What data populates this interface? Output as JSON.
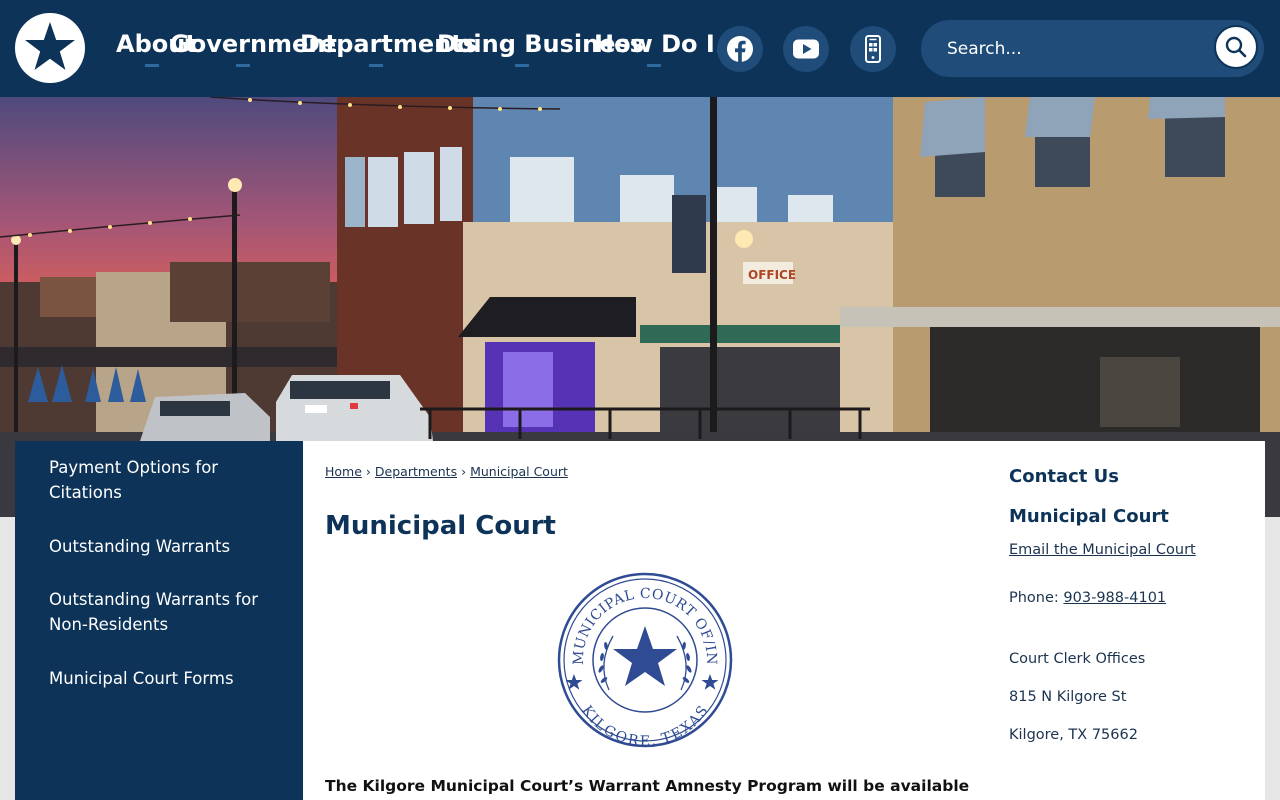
{
  "header": {
    "nav": [
      {
        "label": "About"
      },
      {
        "label": "Government"
      },
      {
        "label": "Departments"
      },
      {
        "label": "Doing Business"
      },
      {
        "label": "How Do I..."
      }
    ],
    "social": [
      {
        "icon": "facebook-icon"
      },
      {
        "icon": "youtube-icon"
      },
      {
        "icon": "mobile-app-icon"
      }
    ],
    "search": {
      "placeholder": "Search..."
    }
  },
  "sidebar": {
    "items": [
      {
        "label": "Payment Options for Citations"
      },
      {
        "label": "Outstanding Warrants"
      },
      {
        "label": "Outstanding Warrants for Non-Residents"
      },
      {
        "label": "Municipal Court Forms"
      }
    ]
  },
  "breadcrumb": [
    "Home",
    "Departments",
    "Municipal Court"
  ],
  "page": {
    "title": "Municipal Court",
    "seal": {
      "top_text": "MUNICIPAL COURT OF/IN",
      "bottom_text": "KILGORE, TEXAS"
    },
    "notice": "The Kilgore Municipal Court’s Warrant Amnesty Program will be available"
  },
  "contact": {
    "heading": "Contact Us",
    "department": "Municipal Court",
    "email_link": "Email the Municipal Court",
    "phone_label": "Phone:",
    "phone": "903-988-4101",
    "office": "Court Clerk Offices",
    "street": "815 N Kilgore St",
    "city": "Kilgore, TX 75662"
  },
  "colors": {
    "header_bg": "#0d3358",
    "accent": "#1f4c78",
    "seal_blue": "#2f4b93"
  }
}
